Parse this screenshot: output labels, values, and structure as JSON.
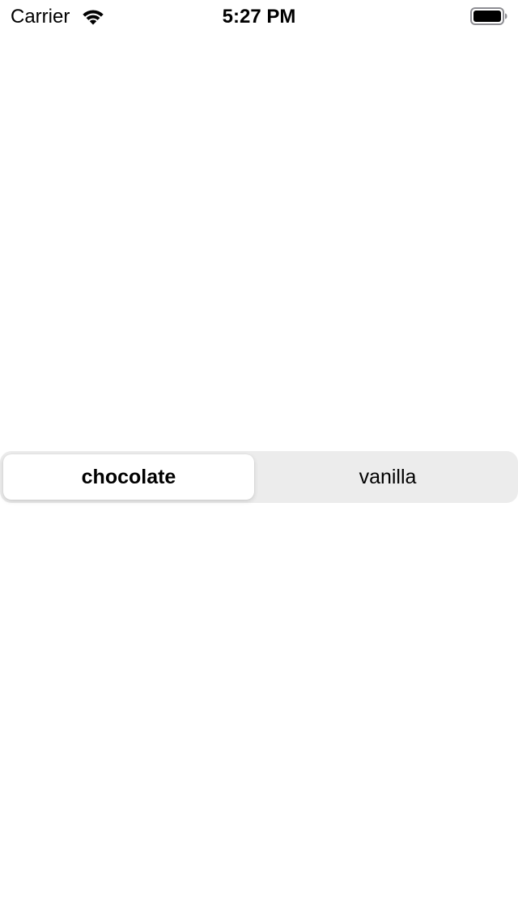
{
  "status_bar": {
    "carrier": "Carrier",
    "time": "5:27 PM",
    "wifi_icon": "wifi-icon",
    "battery_icon": "battery-full-icon"
  },
  "segmented_control": {
    "segments": [
      {
        "label": "chocolate",
        "selected": true
      },
      {
        "label": "vanilla",
        "selected": false
      }
    ],
    "colors": {
      "track": "#ececec",
      "selected_pill": "#ffffff",
      "text": "#000000"
    }
  }
}
